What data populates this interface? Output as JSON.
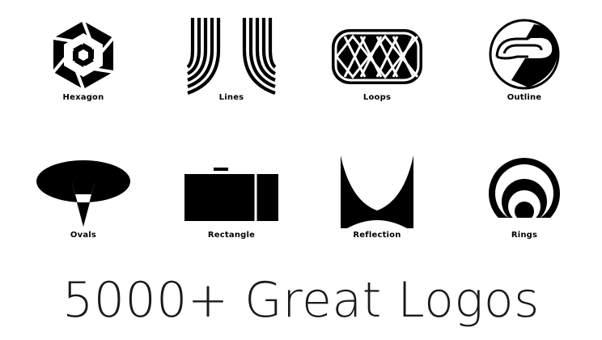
{
  "logos": [
    {
      "label": "Hexagon",
      "icon": "hexagon-icon"
    },
    {
      "label": "Lines",
      "icon": "lines-icon"
    },
    {
      "label": "Loops",
      "icon": "loops-icon"
    },
    {
      "label": "Outline",
      "icon": "outline-icon"
    },
    {
      "label": "Ovals",
      "icon": "ovals-icon"
    },
    {
      "label": "Rectangle",
      "icon": "rectangle-icon"
    },
    {
      "label": "Reflection",
      "icon": "reflection-icon"
    },
    {
      "label": "Rings",
      "icon": "rings-icon"
    }
  ],
  "headline": "5000+ Great Logos",
  "colors": {
    "ink": "#000000",
    "background": "#ffffff",
    "headline": "#1a1a1a"
  }
}
